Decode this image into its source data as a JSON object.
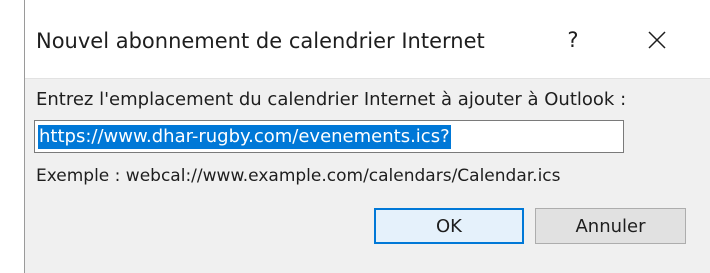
{
  "dialog": {
    "title": "Nouvel abonnement de calendrier Internet",
    "help_label": "?",
    "close_icon": "close-icon",
    "prompt": "Entrez l'emplacement du calendrier Internet à ajouter à Outlook :",
    "url_value": "https://www.dhar-rugby.com/evenements.ics?",
    "example": "Exemple : webcal://www.example.com/calendars/Calendar.ics",
    "ok_label": "OK",
    "cancel_label": "Annuler",
    "accent_color": "#0078d7"
  }
}
